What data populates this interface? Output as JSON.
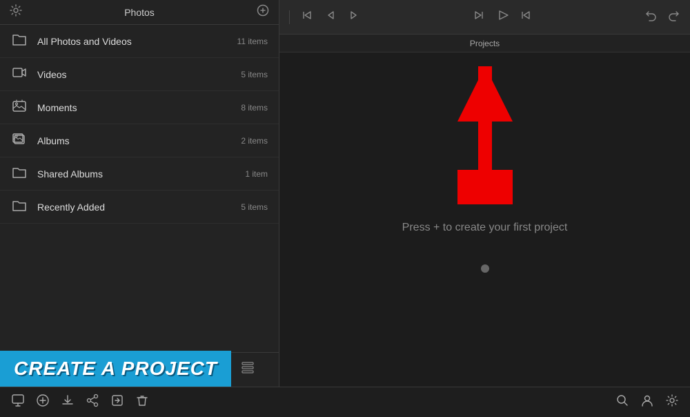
{
  "sidebar": {
    "header": {
      "title": "Photos",
      "settings_icon": "⚙",
      "more_icon": "⊕"
    },
    "items": [
      {
        "id": "all-photos",
        "label": "All Photos and Videos",
        "count": "11 items",
        "icon": "folder"
      },
      {
        "id": "videos",
        "label": "Videos",
        "count": "5 items",
        "icon": "video"
      },
      {
        "id": "moments",
        "label": "Moments",
        "count": "8 items",
        "icon": "camera"
      },
      {
        "id": "albums",
        "label": "Albums",
        "count": "2 items",
        "icon": "album"
      },
      {
        "id": "shared-albums",
        "label": "Shared Albums",
        "count": "1 item",
        "icon": "folder"
      },
      {
        "id": "recently-added",
        "label": "Recently Added",
        "count": "5 items",
        "icon": "folder"
      }
    ],
    "toolbar": {
      "buttons": [
        {
          "id": "check",
          "icon": "✓",
          "label": ""
        },
        {
          "id": "circle",
          "icon": "◉",
          "label": ""
        },
        {
          "id": "create",
          "icon": "▦",
          "label": "CREATE"
        },
        {
          "id": "search",
          "icon": "⌕",
          "label": ""
        },
        {
          "id": "list",
          "icon": "☰",
          "label": ""
        }
      ]
    }
  },
  "timeline": {
    "left_buttons": [
      "⏮",
      "|",
      "⊲",
      "⊳"
    ],
    "right_buttons": [
      "⊲⊲",
      "▷",
      "⊳⊳"
    ],
    "undo_redo": [
      "↩",
      "↪"
    ],
    "projects_label": "Projects"
  },
  "project_area": {
    "empty_message": "Press + to create your first project"
  },
  "bottom_toolbar": {
    "left_icons": [
      "⊞",
      "⊕",
      "⊟",
      "⊠",
      "⊡",
      "⊟"
    ],
    "right_icons": [
      "⌕",
      "⊕",
      "⊟",
      "⚙"
    ]
  },
  "banner": {
    "text": "CREATE A PROJECT"
  },
  "colors": {
    "sidebar_bg": "#232323",
    "content_bg": "#1c1c1c",
    "banner_bg": "#1a9ed4",
    "accent": "#fff"
  }
}
